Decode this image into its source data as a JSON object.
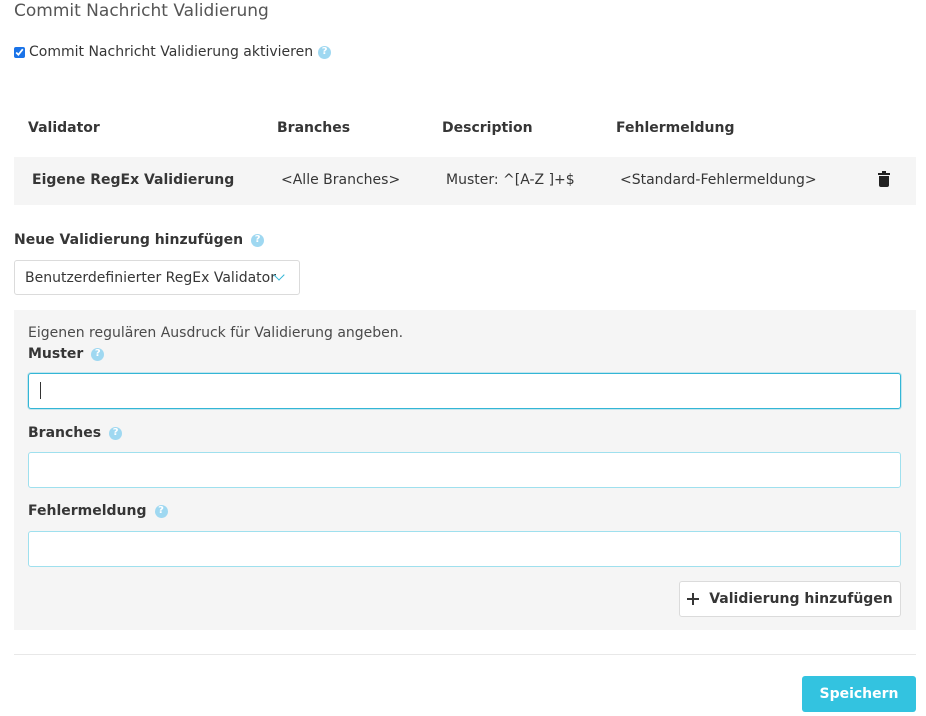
{
  "page": {
    "title": "Commit Nachricht Validierung"
  },
  "enable": {
    "label": "Commit Nachricht Validierung aktivieren",
    "checked": true,
    "help": "?"
  },
  "table": {
    "headers": {
      "validator": "Validator",
      "branches": "Branches",
      "description": "Description",
      "error": "Fehlermeldung"
    },
    "rows": [
      {
        "validator": "Eigene RegEx Validierung",
        "branches": "<Alle Branches>",
        "description": "Muster: ^[A-Z ]+$",
        "error": "<Standard-Fehlermeldung>",
        "action_icon": "trash-icon"
      }
    ]
  },
  "add_section": {
    "label": "Neue Validierung hinzufügen",
    "help": "?",
    "select_value": "Benutzerdefinierter RegEx Validator"
  },
  "form": {
    "hint": "Eigenen regulären Ausdruck für Validierung angeben.",
    "pattern": {
      "label": "Muster",
      "help": "?",
      "value": ""
    },
    "branches": {
      "label": "Branches",
      "help": "?",
      "value": ""
    },
    "error": {
      "label": "Fehlermeldung",
      "help": "?",
      "value": ""
    },
    "add_button": "Validierung hinzufügen"
  },
  "footer": {
    "save_button": "Speichern"
  },
  "colors": {
    "accent": "#33c3e0",
    "help_icon": "#9fd8f1",
    "panel": "#f5f5f5"
  }
}
